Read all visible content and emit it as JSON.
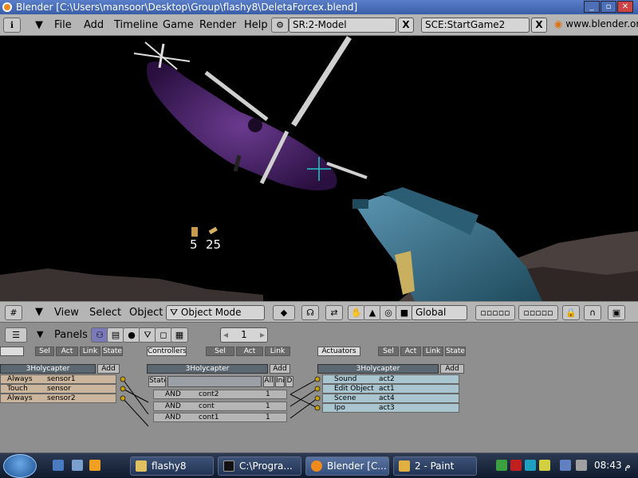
{
  "window": {
    "title": "Blender [C:\\Users\\mansoor\\Desktop\\Group\\flashy8\\DeletaForcex.blend]"
  },
  "menu": {
    "items": [
      "File",
      "Add",
      "Timeline",
      "Game",
      "Render",
      "Help"
    ],
    "screen": "SR:2-Model",
    "scene": "SCE:StartGame2",
    "url": "www.blender.org",
    "close": "X"
  },
  "hud": {
    "pistol_ammo": "5",
    "rifle_ammo": "25"
  },
  "header3d": {
    "view": "View",
    "select": "Select",
    "object": "Object",
    "mode": "Object Mode",
    "orientation": "Global"
  },
  "panel": {
    "label": "Panels",
    "frame": "1",
    "sensors": {
      "buttons": [
        "Sel",
        "Act",
        "Link",
        "State"
      ],
      "object": "3Holycapter",
      "add": "Add",
      "rows": [
        {
          "type": "Always",
          "name": "sensor1"
        },
        {
          "type": "Touch",
          "name": "sensor"
        },
        {
          "type": "Always",
          "name": "sensor2"
        }
      ]
    },
    "controllers": {
      "title": "Controllers",
      "buttons": [
        "Sel",
        "Act",
        "Link"
      ],
      "object": "3Holycapter",
      "add": "Add",
      "state": "State",
      "all": "All",
      "ini": "Ini",
      "d": "D",
      "rows": [
        {
          "type": "AND",
          "name": "cont2",
          "n": "1"
        },
        {
          "type": "AND",
          "name": "cont",
          "n": "1"
        },
        {
          "type": "AND",
          "name": "cont1",
          "n": "1"
        }
      ]
    },
    "actuators": {
      "title": "Actuators",
      "buttons": [
        "Sel",
        "Act",
        "Link",
        "State"
      ],
      "object": "3Holycapter",
      "add": "Add",
      "rows": [
        {
          "type": "Sound",
          "name": "act2"
        },
        {
          "type": "Edit Object",
          "name": "act1"
        },
        {
          "type": "Scene",
          "name": "act4"
        },
        {
          "type": "Ipo",
          "name": "act3"
        }
      ]
    }
  },
  "taskbar": {
    "tasks": [
      "flashy8",
      "C:\\Progra...",
      "Blender [C...",
      "2 - Paint"
    ],
    "clock": "08:43 م"
  },
  "colors": {
    "titlebar": "#3b5ea8",
    "panel": "#8f8f8f",
    "heli": "#4a2a6a"
  }
}
